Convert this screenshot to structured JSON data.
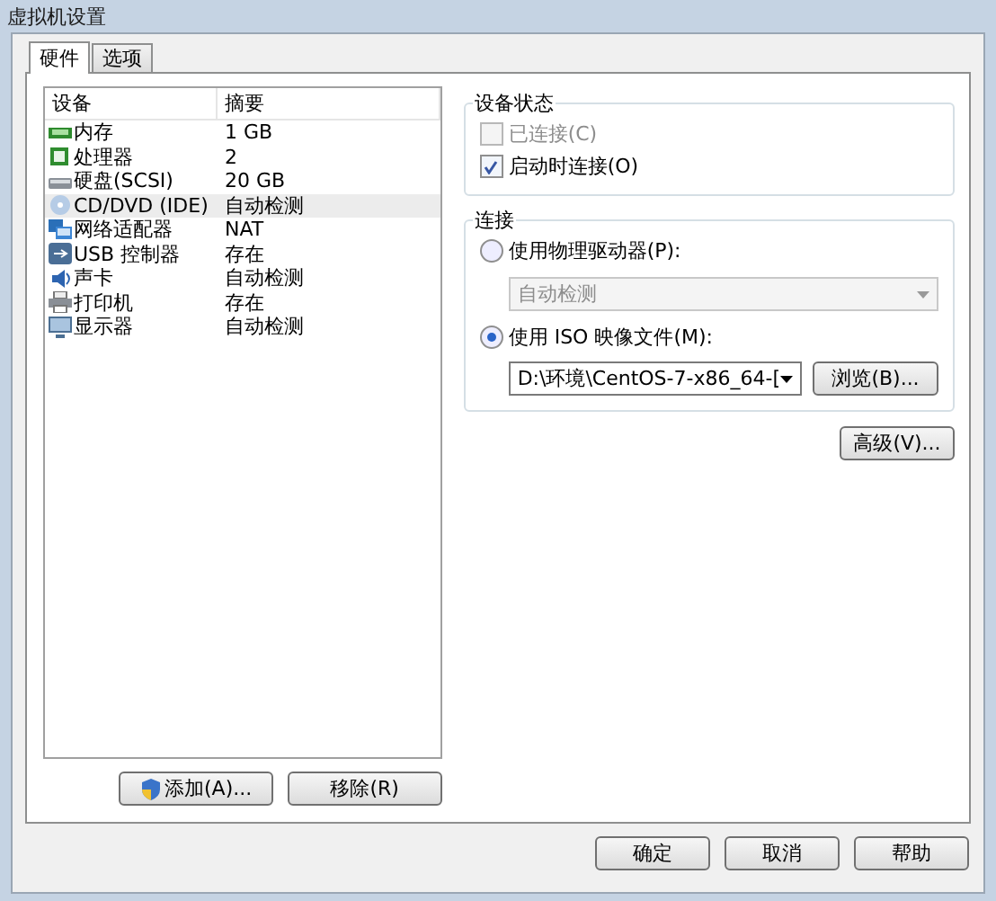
{
  "window": {
    "title": "虚拟机设置"
  },
  "tabs": [
    {
      "label": "硬件",
      "selected": true
    },
    {
      "label": "选项",
      "selected": false
    }
  ],
  "device_list": {
    "columns": [
      "设备",
      "摘要"
    ],
    "rows": [
      {
        "kind": "memory",
        "device": "内存",
        "summary": "1 GB",
        "selected": false
      },
      {
        "kind": "cpu",
        "device": "处理器",
        "summary": "2",
        "selected": false
      },
      {
        "kind": "disk",
        "device": "硬盘(SCSI)",
        "summary": "20 GB",
        "selected": false
      },
      {
        "kind": "cd",
        "device": "CD/DVD (IDE)",
        "summary": "自动检测",
        "selected": true
      },
      {
        "kind": "network",
        "device": "网络适配器",
        "summary": "NAT",
        "selected": false
      },
      {
        "kind": "usb",
        "device": "USB 控制器",
        "summary": "存在",
        "selected": false
      },
      {
        "kind": "sound",
        "device": "声卡",
        "summary": "自动检测",
        "selected": false
      },
      {
        "kind": "printer",
        "device": "打印机",
        "summary": "存在",
        "selected": false
      },
      {
        "kind": "display",
        "device": "显示器",
        "summary": "自动检测",
        "selected": false
      }
    ],
    "buttons": [
      "添加(A)...",
      "移除(R)"
    ]
  },
  "device_status": {
    "title": "设备状态",
    "options": [
      {
        "label": "已连接(C)",
        "checked": false,
        "disabled": true
      },
      {
        "label": "启动时连接(O)",
        "checked": true,
        "disabled": false
      }
    ]
  },
  "connection": {
    "title": "连接",
    "physical": {
      "label": "使用物理驱动器(P):",
      "selected": false,
      "dropdown": "自动检测"
    },
    "iso": {
      "label": "使用 ISO 映像文件(M):",
      "selected": true,
      "path": "D:\\环境\\CentOS-7-x86_64-[",
      "browse": "浏览(B)..."
    }
  },
  "advanced_button": "高级(V)...",
  "footer_buttons": [
    "确定",
    "取消",
    "帮助"
  ]
}
